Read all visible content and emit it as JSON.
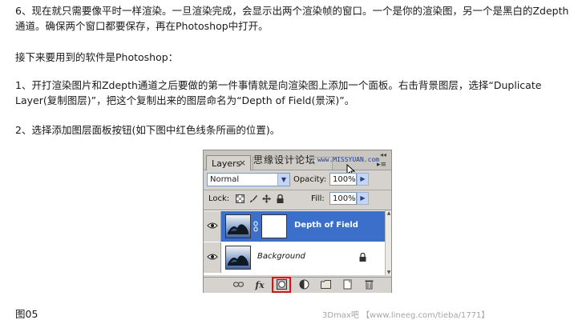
{
  "article": {
    "para1": "6、现在就只需要像平时一样渲染。一旦渲染完成，会显示出两个渲染帧的窗口。一个是你的渲染图，另一个是黑白的Zdepth通道。确保两个窗口都要保存，再在Photoshop中打开。",
    "para2": "接下来要用到的软件是Photoshop：",
    "para3": "1、开打渲染图片和Zdepth通道之后要做的第一件事情就是向渲染图上添加一个面板。右击背景图层，选择“Duplicate Layer(复制图层)”，把这个复制出来的图层命名为“Depth of Field(景深)”。",
    "para4": "2、选择添加图层面板按钮(如下图中红色线条所画的位置)。",
    "caption": "图05"
  },
  "panel": {
    "tab_layers": "Layers",
    "tab_close": "×",
    "tab_channels": "",
    "collapse": "◂◂",
    "menu": "▸≡",
    "overlay_watermark": "思缘设计论坛",
    "overlay_url": "www.MISSYUAN.com",
    "blend_mode": "Normal",
    "opacity_label": "Opacity:",
    "opacity_value": "100%",
    "lock_label": "Lock:",
    "fill_label": "Fill:",
    "fill_value": "100%",
    "layers": [
      {
        "name": "Depth of Field",
        "selected": true,
        "visible": true,
        "has_mask": true
      },
      {
        "name": "Background",
        "selected": false,
        "visible": true,
        "locked": true
      }
    ],
    "footer_icons": [
      "link-icon",
      "fx-icon",
      "add-mask-icon",
      "adjustment-icon",
      "folder-icon",
      "new-layer-icon",
      "trash-icon"
    ],
    "highlight_color": "#e01010",
    "selected_color": "#3b6fc9"
  },
  "footer_watermark": "3Dmax吧 【www.lineeg.com/tieba/1771】"
}
